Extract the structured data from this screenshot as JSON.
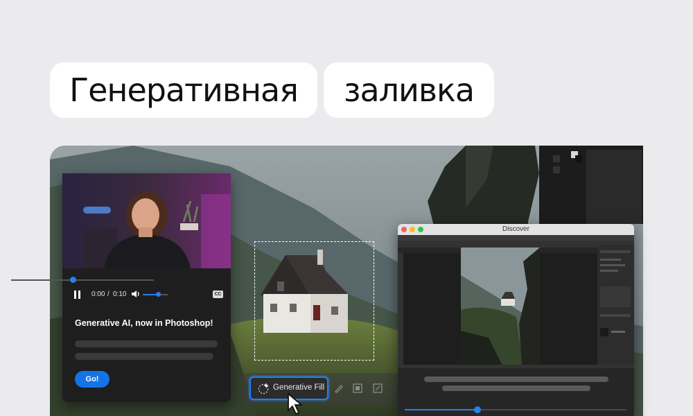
{
  "heading": {
    "word1": "Генеративная",
    "word2": "заливка"
  },
  "video_card": {
    "time_current": "0:00",
    "time_separator": "/",
    "time_total": "0:10",
    "playback_progress": 0.0,
    "volume_level": 0.6,
    "cc_label": "CC",
    "title": "Generative AI, now in Photoshop!",
    "go_label": "Go!"
  },
  "context_toolbar": {
    "generative_fill_label": "Generative Fill"
  },
  "discover_window": {
    "title": "Discover",
    "slider_value": 0.33
  },
  "colors": {
    "accent": "#1473e6",
    "highlight": "#2680eb",
    "background": "#ebebed"
  }
}
